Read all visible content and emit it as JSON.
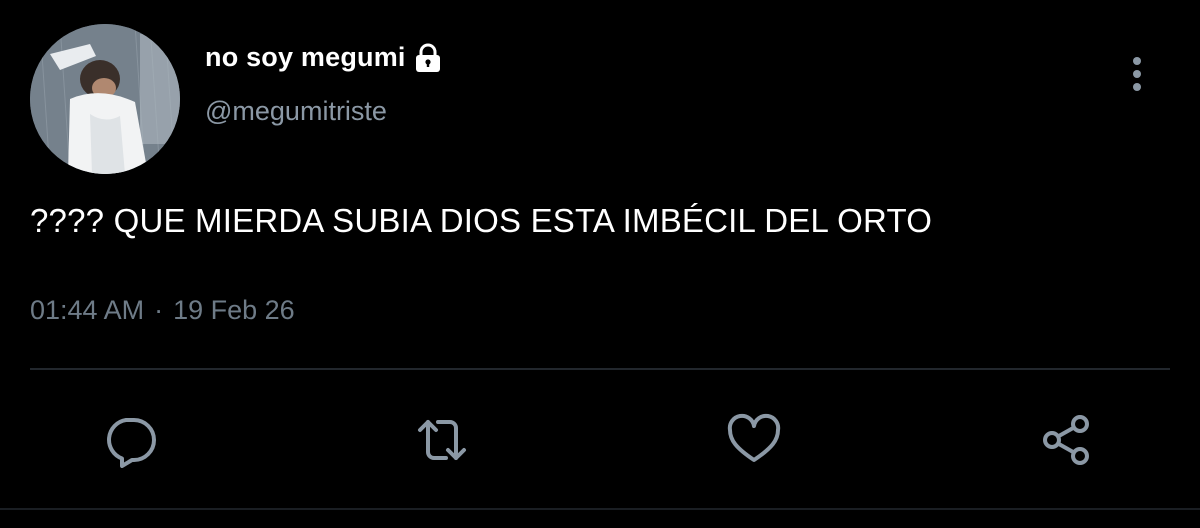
{
  "author": {
    "display_name": "no soy megumi",
    "handle": "@megumitriste",
    "protected": true
  },
  "tweet": {
    "text": "???? QUE MIERDA SUBIA DIOS ESTA IMBÉCIL DEL ORTO",
    "time": "01:44 AM",
    "separator": "·",
    "date": "19 Feb 26"
  },
  "icons": {
    "lock": "lock-icon",
    "more": "more-vertical-icon",
    "reply": "reply-icon",
    "retweet": "retweet-icon",
    "like": "heart-icon",
    "share": "share-icon"
  },
  "colors": {
    "background": "#000000",
    "primary_text": "#ffffff",
    "secondary_text": "#8b98a5",
    "icon": "#8b98a5",
    "divider": "#22272d"
  }
}
